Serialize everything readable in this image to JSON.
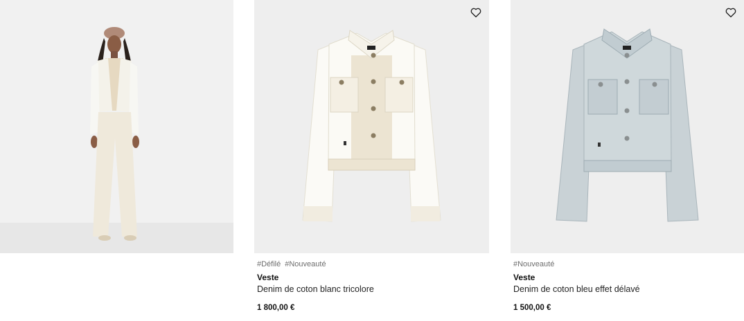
{
  "products": [
    {
      "image_alt": "look-model-white-denim"
    },
    {
      "tags": [
        "#Défilé",
        "#Nouveauté"
      ],
      "name": "Veste",
      "description": "Denim de coton blanc tricolore",
      "price": "1 800,00 €",
      "wishlist_icon": "heart-outline-icon"
    },
    {
      "tags": [
        "#Nouveauté"
      ],
      "name": "Veste",
      "description": "Denim de coton bleu effet délavé",
      "price": "1 500,00 €",
      "wishlist_icon": "heart-outline-icon"
    }
  ],
  "colors": {
    "background": "#ffffff",
    "image_bg": "#eeeeee",
    "tag_text": "#6d6d6d",
    "text": "#111111"
  }
}
